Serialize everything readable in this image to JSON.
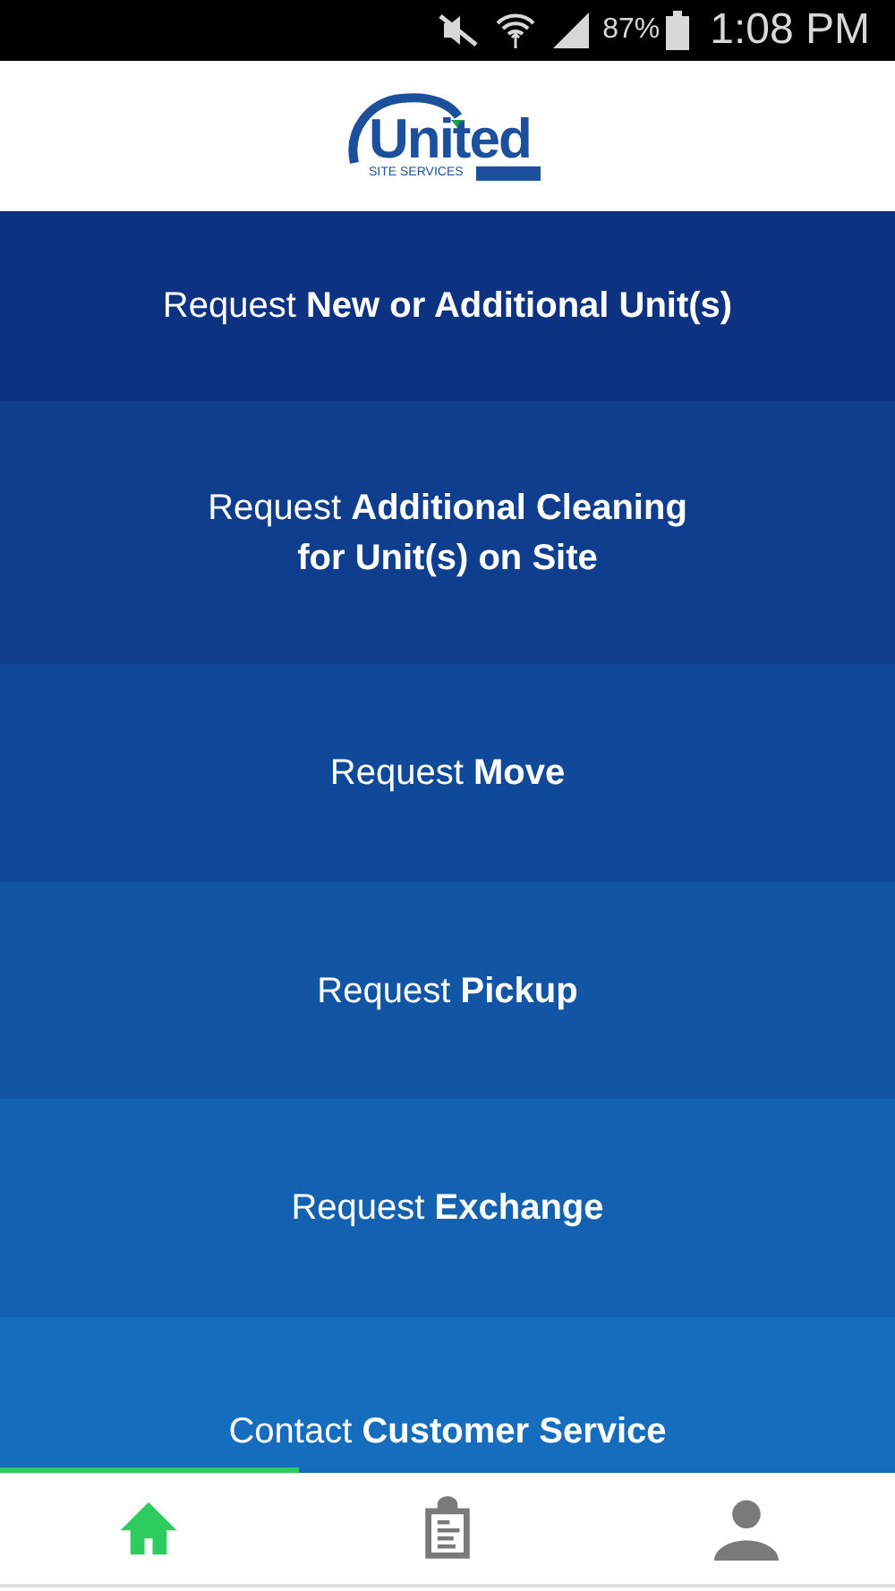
{
  "status_bar": {
    "battery": "87%",
    "time": "1:08 PM"
  },
  "logo": {
    "name": "United",
    "tagline": "SITE SERVICES"
  },
  "menu": [
    {
      "lines": [
        "Request **New or Additional Unit(s)**"
      ]
    },
    {
      "lines": [
        "Request **Additional Cleaning**",
        "**for Unit(s) on Site**"
      ]
    },
    {
      "lines": [
        "Request **Move**"
      ]
    },
    {
      "lines": [
        "Request **Pickup**"
      ]
    },
    {
      "lines": [
        "Request **Exchange**"
      ]
    },
    {
      "lines": [
        "Contact **Customer Service**"
      ]
    }
  ],
  "tabs": [
    {
      "kind": "home",
      "selected": true
    },
    {
      "kind": "clipboard",
      "selected": false
    },
    {
      "kind": "person",
      "selected": false
    }
  ]
}
